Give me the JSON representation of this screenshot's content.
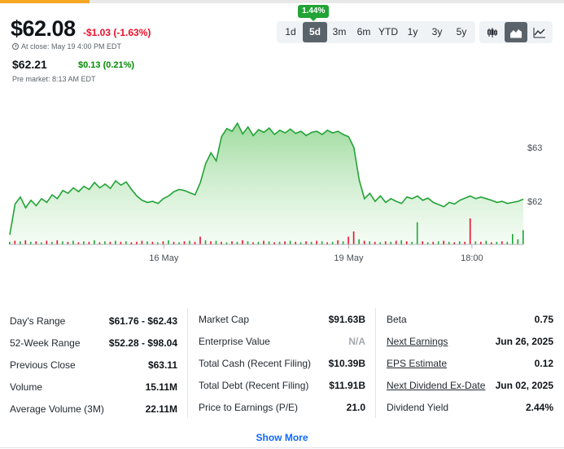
{
  "quote": {
    "price": "$62.08",
    "change": "-$1.03 (-1.63%)",
    "close_label": "At close: May 19 4:00 PM EDT",
    "pre_price": "$62.21",
    "pre_change": "$0.13 (0.21%)",
    "pre_label": "Pre market: 8:13 AM EDT"
  },
  "range_badge": "1.44%",
  "ranges": [
    {
      "label": "1d",
      "active": false
    },
    {
      "label": "5d",
      "active": true
    },
    {
      "label": "3m",
      "active": false
    },
    {
      "label": "6m",
      "active": false
    },
    {
      "label": "YTD",
      "active": false
    },
    {
      "label": "1y",
      "active": false
    },
    {
      "label": "3y",
      "active": false
    },
    {
      "label": "5y",
      "active": false
    }
  ],
  "chart_types": [
    {
      "icon": "candlestick-chart-icon",
      "active": false
    },
    {
      "icon": "area-chart-icon",
      "active": true
    },
    {
      "icon": "line-chart-icon",
      "active": false
    }
  ],
  "colors": {
    "line": "#21a336",
    "fill_top": "#9ad99a",
    "fill_bottom": "#eefaee",
    "volume_up": "#21a336",
    "volume_down": "#eb0f29",
    "negative": "#eb0f29",
    "positive": "#008a00",
    "link": "#0f69ff"
  },
  "chart_data": {
    "type": "area",
    "ylim": [
      61.2,
      63.8
    ],
    "y_ticks": [
      {
        "label": "$63",
        "value": 63
      },
      {
        "label": "$62",
        "value": 62
      }
    ],
    "x_ticks": [
      {
        "label": "16 May",
        "x": 0.3
      },
      {
        "label": "19 May",
        "x": 0.66
      },
      {
        "label": "18:00",
        "x": 0.9
      }
    ],
    "grid": false,
    "series": [
      {
        "values": [
          61.38,
          61.95,
          62.08,
          61.88,
          62.02,
          61.92,
          62.05,
          61.98,
          62.12,
          62.05,
          62.2,
          62.15,
          62.25,
          62.18,
          62.28,
          62.22,
          62.35,
          62.25,
          62.32,
          62.24,
          62.38,
          62.3,
          62.36,
          62.22,
          62.1,
          62.02,
          61.98,
          62.0,
          61.96,
          62.05,
          62.1,
          62.18,
          62.22,
          62.2,
          62.16,
          62.12,
          62.35,
          62.7,
          62.9,
          62.75,
          63.2,
          63.35,
          63.3,
          63.45,
          63.25,
          63.38,
          63.22,
          63.33,
          63.28,
          63.36,
          63.24,
          63.32,
          63.27,
          63.34,
          63.26,
          63.3,
          63.22,
          63.28,
          63.3,
          63.24,
          63.32,
          63.27,
          63.3,
          63.24,
          63.2,
          63.0,
          62.4,
          62.05,
          62.15,
          62.0,
          62.1,
          61.98,
          62.05,
          62.0,
          61.96,
          62.08,
          62.05,
          62.1,
          62.02,
          62.06,
          61.98,
          61.94,
          61.9,
          61.98,
          61.95,
          62.02,
          62.06,
          62.1,
          62.05,
          62.08,
          62.05,
          62.02,
          61.98,
          62.0,
          61.96,
          61.98,
          62.0,
          62.04
        ],
        "volume": [
          0.1,
          0.14,
          0.12,
          0.16,
          0.1,
          0.12,
          0.08,
          0.14,
          0.1,
          0.16,
          0.12,
          0.1,
          0.14,
          0.08,
          0.12,
          0.1,
          0.16,
          0.08,
          0.12,
          0.1,
          0.14,
          0.1,
          0.12,
          0.08,
          0.1,
          0.14,
          0.12,
          0.1,
          0.08,
          0.12,
          0.16,
          0.1,
          0.08,
          0.12,
          0.14,
          0.1,
          0.3,
          0.16,
          0.12,
          0.14,
          0.1,
          0.08,
          0.12,
          0.1,
          0.16,
          0.12,
          0.08,
          0.1,
          0.14,
          0.12,
          0.08,
          0.1,
          0.12,
          0.14,
          0.1,
          0.08,
          0.12,
          0.1,
          0.14,
          0.12,
          0.08,
          0.1,
          0.16,
          0.12,
          0.3,
          0.5,
          0.2,
          0.14,
          0.12,
          0.1,
          0.08,
          0.12,
          0.1,
          0.14,
          0.16,
          0.12,
          0.1,
          0.85,
          0.12,
          0.08,
          0.1,
          0.12,
          0.14,
          0.1,
          0.08,
          0.12,
          0.1,
          1.0,
          0.12,
          0.1,
          0.14,
          0.08,
          0.1,
          0.12,
          0.1,
          0.4,
          0.2,
          0.55
        ],
        "volume_up": [
          1,
          0,
          1,
          0,
          1,
          0,
          1,
          0,
          1,
          0,
          1,
          0,
          1,
          0,
          1,
          0,
          1,
          0,
          1,
          0,
          1,
          0,
          1,
          0,
          0,
          0,
          1,
          0,
          1,
          0,
          1,
          0,
          1,
          0,
          1,
          0,
          0,
          1,
          0,
          1,
          0,
          1,
          0,
          1,
          0,
          1,
          0,
          1,
          0,
          1,
          0,
          1,
          0,
          1,
          0,
          1,
          0,
          1,
          0,
          1,
          0,
          1,
          0,
          1,
          0,
          0,
          1,
          0,
          1,
          0,
          1,
          0,
          1,
          0,
          1,
          0,
          1,
          1,
          0,
          1,
          0,
          1,
          0,
          1,
          0,
          1,
          0,
          0,
          1,
          0,
          1,
          0,
          1,
          0,
          1,
          1,
          1,
          1
        ]
      }
    ]
  },
  "stats": {
    "col1": [
      {
        "label": "Day's Range",
        "value": "$61.76 - $62.43"
      },
      {
        "label": "52-Week Range",
        "value": "$52.28 - $98.04"
      },
      {
        "label": "Previous Close",
        "value": "$63.11"
      },
      {
        "label": "Volume",
        "value": "15.11M"
      },
      {
        "label": "Average Volume (3M)",
        "value": "22.11M"
      }
    ],
    "col2": [
      {
        "label": "Market Cap",
        "value": "$91.63B"
      },
      {
        "label": "Enterprise Value",
        "value": "N/A"
      },
      {
        "label": "Total Cash (Recent Filing)",
        "value": "$10.39B"
      },
      {
        "label": "Total Debt (Recent Filing)",
        "value": "$11.91B"
      },
      {
        "label": "Price to Earnings (P/E)",
        "value": "21.0"
      }
    ],
    "col3": [
      {
        "label": "Beta",
        "value": "0.75",
        "link": false
      },
      {
        "label": "Next Earnings",
        "value": "Jun 26, 2025",
        "link": true
      },
      {
        "label": "EPS Estimate",
        "value": "0.12",
        "link": true
      },
      {
        "label": "Next Dividend Ex-Date",
        "value": "Jun 02, 2025",
        "link": true
      },
      {
        "label": "Dividend Yield",
        "value": "2.44%",
        "link": false
      }
    ]
  },
  "show_more": "Show More"
}
